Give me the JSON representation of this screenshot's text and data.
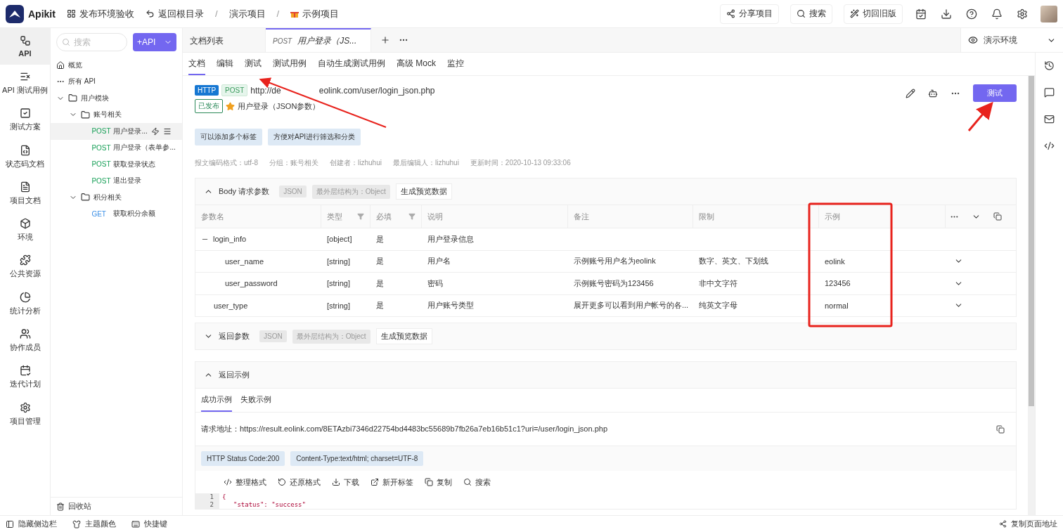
{
  "app": {
    "name": "Apikit"
  },
  "top_bar": {
    "workspace": "发布环境验收",
    "back": "返回根目录",
    "breadcrumbs": [
      {
        "separator": "/",
        "label": "演示项目"
      },
      {
        "separator": "/",
        "label": "示例项目"
      }
    ],
    "actions": [
      {
        "label": "分享项目",
        "kind": "share"
      },
      {
        "label": "搜索",
        "kind": "search"
      },
      {
        "label": "切回旧版",
        "kind": "wand"
      }
    ]
  },
  "nav": [
    {
      "label": "API",
      "kind": "api",
      "selected": true
    },
    {
      "label": "API 测试用例",
      "kind": "cases",
      "selected": false
    },
    {
      "label": "测试方案",
      "kind": "plan",
      "selected": false
    },
    {
      "label": "状态码文档",
      "kind": "code",
      "selected": false
    },
    {
      "label": "项目文档",
      "kind": "doc",
      "selected": false
    },
    {
      "label": "环境",
      "kind": "env",
      "selected": false
    },
    {
      "label": "公共资源",
      "kind": "resource",
      "selected": false
    },
    {
      "label": "统计分析",
      "kind": "stats",
      "selected": false
    },
    {
      "label": "协作成员",
      "kind": "members",
      "selected": false
    },
    {
      "label": "迭代计划",
      "kind": "iteration",
      "selected": false
    },
    {
      "label": "项目管理",
      "kind": "settings",
      "selected": false
    }
  ],
  "tree": {
    "search": {
      "placeholder": "搜索"
    },
    "add_button": "+API",
    "items": [
      {
        "kind": "home_link",
        "label": "概览"
      },
      {
        "kind": "all_link",
        "label": "所有 API"
      },
      {
        "kind": "folder",
        "label": "用户模块",
        "expanded": true,
        "children": [
          {
            "kind": "folder",
            "label": "账号相关",
            "expanded": true,
            "children": [
              {
                "kind": "api",
                "method": "POST",
                "color": "#18a058",
                "label": "用户登录...",
                "selected": true
              },
              {
                "kind": "api",
                "method": "POST",
                "color": "#18a058",
                "label": "用户登录（表单参...",
                "selected": false
              },
              {
                "kind": "api",
                "method": "POST",
                "color": "#18a058",
                "label": "获取登录状态",
                "selected": false
              },
              {
                "kind": "api",
                "method": "POST",
                "color": "#18a058",
                "label": "退出登录",
                "selected": false
              }
            ]
          },
          {
            "kind": "folder",
            "label": "积分相关",
            "expanded": true,
            "children": [
              {
                "kind": "api",
                "method": "GET",
                "color": "#3a8ee6",
                "label": "获取积分余额",
                "selected": false
              }
            ]
          }
        ]
      }
    ],
    "recycle": "回收站"
  },
  "tabs": [
    {
      "label": "文档列表",
      "selected": false
    },
    {
      "method": "POST",
      "label": "用户登录（JS...",
      "selected": true
    }
  ],
  "environment": "演示环境",
  "sub_tabs": [
    {
      "label": "文档",
      "selected": true
    },
    {
      "label": "编辑",
      "selected": false
    },
    {
      "label": "测试",
      "selected": false
    },
    {
      "label": "测试用例",
      "selected": false
    },
    {
      "label": "自动生成测试用例",
      "selected": false
    },
    {
      "label": "高级 Mock",
      "selected": false
    },
    {
      "label": "监控",
      "selected": false
    }
  ],
  "api": {
    "protocol": "HTTP",
    "method": "POST",
    "url_parts": [
      "http://de",
      "eolink.com/user/login_json.php"
    ],
    "status": "已发布",
    "starred": true,
    "title": "用户登录（JSON参数）",
    "test_button": "测试",
    "tags": [
      {
        "label": "可以添加多个标签"
      },
      {
        "label": "方便对API进行筛选和分类"
      }
    ],
    "meta": [
      {
        "label": "报文编码格式：utf-8"
      },
      {
        "label": "分组：账号相关"
      },
      {
        "label": "创建者：lizhuhui"
      },
      {
        "label": "最后编辑人：lizhuhui"
      },
      {
        "label": "更新时间：2020-10-13 09:33:06"
      }
    ]
  },
  "body_params": {
    "title": "Body 请求参数",
    "expanded": true,
    "format": "JSON",
    "root": "最外层结构为：Object",
    "preview": "生成预览数据",
    "columns": [
      {
        "label": "参数名",
        "filter": false
      },
      {
        "label": "类型",
        "filter": true
      },
      {
        "label": "必填",
        "filter": true
      },
      {
        "label": "说明",
        "filter": false
      },
      {
        "label": "备注",
        "filter": false
      },
      {
        "label": "限制",
        "filter": false
      },
      {
        "label": "示例",
        "filter": false
      }
    ],
    "rows": [
      {
        "name": "login_info",
        "type": "[object]",
        "required": "是",
        "description": "用户登录信息",
        "expanded": true,
        "children": [
          {
            "name": "user_name",
            "type": "[string]",
            "required": "是",
            "description": "用户名",
            "note": "示例账号用户名为eolink",
            "limit": "数字、英文、下划线",
            "example": "eolink"
          },
          {
            "name": "user_password",
            "type": "[string]",
            "required": "是",
            "description": "密码",
            "note": "示例账号密码为123456",
            "limit": "非中文字符",
            "example": "123456"
          }
        ]
      },
      {
        "name": "user_type",
        "type": "[string]",
        "required": "是",
        "description": "用户账号类型",
        "note": "展开更多可以看到用户帐号的各...",
        "limit": "纯英文字母",
        "example": "normal"
      }
    ]
  },
  "return_params": {
    "title": "返回参数",
    "expanded": false,
    "format": "JSON",
    "root": "最外层结构为：Object",
    "preview": "生成预览数据"
  },
  "return_example": {
    "title": "返回示例",
    "expanded": true,
    "tabs": [
      {
        "label": "成功示例",
        "selected": true
      },
      {
        "label": "失败示例",
        "selected": false
      }
    ],
    "request_url": "请求地址：https://result.eolink.com/8ETAzbi7346d22754bd4483bc55689b7fb26a7eb16b51c1?uri=/user/login_json.php",
    "chips": [
      {
        "label": "HTTP Status Code:200"
      },
      {
        "label": "Content-Type:text/html; charset=UTF-8"
      }
    ],
    "toolbar": [
      {
        "label": "整理格式",
        "kind": "format"
      },
      {
        "label": "还原格式",
        "kind": "undo"
      },
      {
        "label": "下载",
        "kind": "download"
      },
      {
        "label": "新开标签",
        "kind": "open"
      },
      {
        "label": "复制",
        "kind": "copy"
      },
      {
        "label": "搜索",
        "kind": "search"
      }
    ],
    "code": [
      {
        "number": "1",
        "text": "{"
      },
      {
        "number": "2",
        "text": "\"status\": \"success\""
      }
    ]
  },
  "status_bar": {
    "left": [
      {
        "label": "隐藏侧边栏",
        "kind": "sidebar"
      },
      {
        "label": "主题颜色",
        "kind": "theme"
      },
      {
        "label": "快捷键",
        "kind": "keyboard"
      }
    ],
    "right": "复制页面地址"
  }
}
